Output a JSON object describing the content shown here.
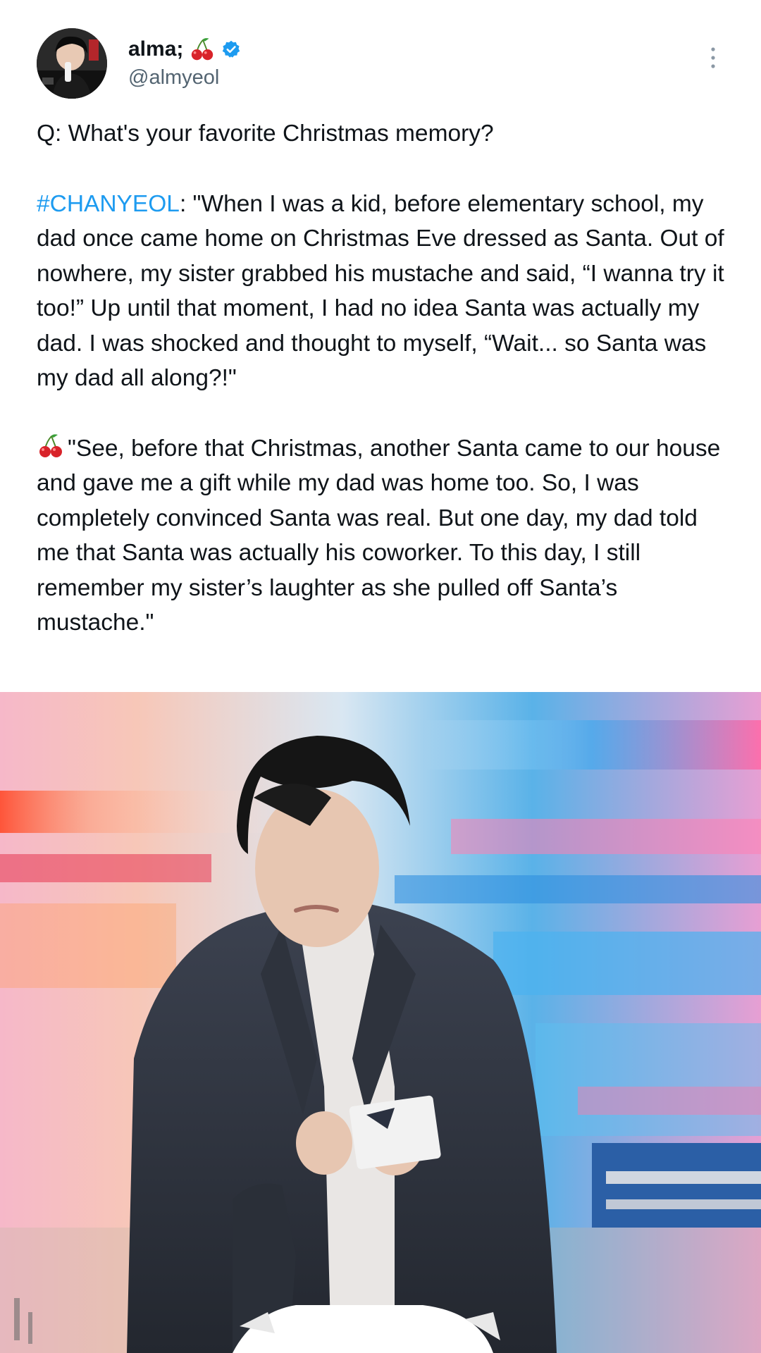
{
  "author": {
    "display_name": "alma;",
    "handle": "@almyeol",
    "name_emoji": "cherries-icon",
    "verified_color": "#1d9bf0"
  },
  "tweet": {
    "question": "Q: What's your favorite Christmas memory?",
    "hashtag": "#CHANYEOL",
    "quote1_rest": ": \"When I was a kid, before elementary school, my dad once came home on Christmas Eve dressed as Santa. Out of nowhere, my sister grabbed his mustache and said, “I wanna try it too!” Up until that moment, I had no idea Santa was actually my dad. I was shocked and thought to myself, “Wait... so Santa was my dad all along?!\"",
    "quote2": "\"See, before that Christmas, another Santa came to our house and gave me a gift while my dad was home too. So, I was completely convinced Santa was real. But one day, my dad told me that Santa was actually his coworker. To this day, I still remember my sister’s laughter as she pulled off Santa’s mustache.\""
  },
  "colors": {
    "text": "#0f1419",
    "secondary": "#536471",
    "link": "#1d9bf0"
  }
}
